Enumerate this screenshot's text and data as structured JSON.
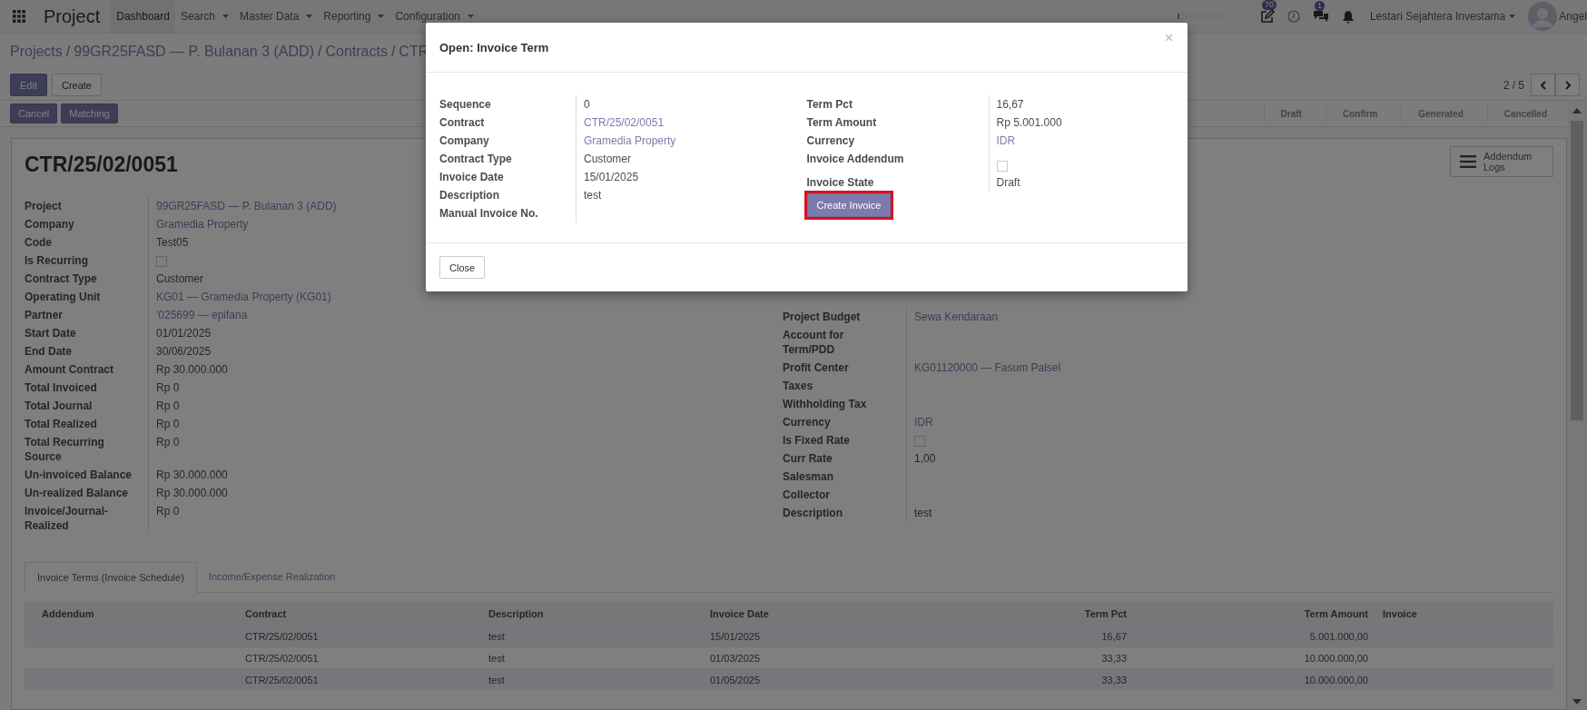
{
  "navbar": {
    "app": "Project",
    "menus": [
      {
        "label": "Dashboard",
        "selected": true,
        "dropdown": false
      },
      {
        "label": "Search",
        "selected": false,
        "dropdown": true
      },
      {
        "label": "Master Data",
        "selected": false,
        "dropdown": true
      },
      {
        "label": "Reporting",
        "selected": false,
        "dropdown": true
      },
      {
        "label": "Configuration",
        "selected": false,
        "dropdown": true
      }
    ],
    "progress": {
      "level": 0.04
    },
    "systray": [
      {
        "kind": "edit",
        "badge": "70"
      },
      {
        "kind": "clock"
      },
      {
        "kind": "chat",
        "badge": "1"
      },
      {
        "kind": "bell"
      }
    ],
    "company": "Lestari Sejahtera Investama",
    "user": "Angel"
  },
  "breadcrumb": [
    {
      "label": "Projects",
      "separator": "/"
    },
    {
      "label": "99GR25FASD — P. Bulanan 3 (ADD)",
      "separator": "/"
    },
    {
      "label": "Contracts",
      "separator": "/"
    },
    {
      "label": "CTR"
    }
  ],
  "buttons": [
    "Edit",
    "Create"
  ],
  "pager": {
    "text": "2 / 5"
  },
  "header_buttons": [
    "Cancel",
    "Matching"
  ],
  "statusbar": [
    {
      "label": "Draft",
      "selected": false
    },
    {
      "label": "Confirm",
      "selected": false
    },
    {
      "label": "Generated",
      "selected": false
    },
    {
      "label": "Cancelled",
      "selected": false
    }
  ],
  "record": {
    "title": "CTR/25/02/0051",
    "addendum_button": "Addendum Logs",
    "left_fields": [
      {
        "label": "Project",
        "kind": "link",
        "value": "99GR25FASD — P. Bulanan 3 (ADD)"
      },
      {
        "label": "Company",
        "kind": "link",
        "value": "Gramedia Property"
      },
      {
        "label": "Code",
        "kind": "text",
        "value": "Test05"
      },
      {
        "label": "Is Recurring",
        "kind": "checkbox",
        "checked": false
      },
      {
        "label": "Contract Type",
        "kind": "text",
        "value": "Customer"
      },
      {
        "label": "Operating Unit",
        "kind": "link",
        "value": "KG01 — Gramedia Property (KG01)"
      },
      {
        "label": "Partner",
        "kind": "link",
        "value": "'025699 — epifana"
      },
      {
        "label": "Start Date",
        "kind": "text",
        "value": "01/01/2025"
      },
      {
        "label": "End Date",
        "kind": "text",
        "value": "30/06/2025"
      },
      {
        "label": "Amount Contract",
        "kind": "text",
        "value": "Rp 30.000.000"
      },
      {
        "label": "Total Invoiced",
        "kind": "text",
        "value": "Rp 0"
      },
      {
        "label": "Total Journal",
        "kind": "text",
        "value": "Rp 0"
      },
      {
        "label": "Total Realized",
        "kind": "text",
        "value": "Rp 0"
      },
      {
        "label": "Total Recurring Source",
        "kind": "text",
        "value": "Rp 0"
      },
      {
        "label": "Un-invoiced Balance",
        "kind": "text",
        "value": "Rp 30.000.000"
      },
      {
        "label": "Un-realized Balance",
        "kind": "text",
        "value": "Rp 30.000.000"
      },
      {
        "label": "Invoice/Journal-Realized",
        "kind": "text",
        "value": "Rp 0"
      }
    ],
    "right_fields": [
      {
        "label": "Project Budget",
        "kind": "link",
        "value": "Sewa Kendaraan"
      },
      {
        "label": "Account for Term/PDD",
        "kind": "text"
      },
      {
        "label": "Profit Center",
        "kind": "link",
        "value": "KG01120000 — Fasum Palsel"
      },
      {
        "label": "Taxes",
        "kind": "text"
      },
      {
        "label": "Withholding Tax",
        "kind": "text"
      },
      {
        "label": "Currency",
        "kind": "link",
        "value": "IDR"
      },
      {
        "label": "Is Fixed Rate",
        "kind": "checkbox",
        "checked": false
      },
      {
        "label": "Curr Rate",
        "kind": "text",
        "value": "1,00"
      },
      {
        "label": "Salesman",
        "kind": "text"
      },
      {
        "label": "Collector",
        "kind": "text"
      },
      {
        "label": "Description",
        "kind": "text",
        "value": "test"
      }
    ]
  },
  "tabs": [
    {
      "label": "Invoice Terms (Invoice Schedule)",
      "selected": true
    },
    {
      "label": "Income/Expense Realization",
      "selected": false
    }
  ],
  "table": {
    "columns": [
      "Addendum",
      "Contract",
      "Description",
      "Invoice Date",
      "Term Pct",
      "Term Amount",
      "Invoice"
    ],
    "rows": [
      [
        "",
        "CTR/25/02/0051",
        "test",
        "15/01/2025",
        "16,67",
        "5.001.000,00",
        ""
      ],
      [
        "",
        "CTR/25/02/0051",
        "test",
        "01/03/2025",
        "33,33",
        "10.000.000,00",
        ""
      ],
      [
        "",
        "CTR/25/02/0051",
        "test",
        "01/05/2025",
        "33,33",
        "10.000.000,00",
        ""
      ]
    ]
  },
  "dialog": {
    "title": "Open: Invoice Term",
    "left_fields": [
      {
        "label": "Sequence",
        "kind": "text",
        "value": "0"
      },
      {
        "label": "Contract",
        "kind": "link",
        "value": "CTR/25/02/0051"
      },
      {
        "label": "Company",
        "kind": "link",
        "value": "Gramedia Property"
      },
      {
        "label": "Contract Type",
        "kind": "text",
        "value": "Customer"
      },
      {
        "label": "Invoice Date",
        "kind": "text",
        "value": "15/01/2025"
      },
      {
        "label": "Description",
        "kind": "text",
        "value": "test"
      },
      {
        "label": "Manual Invoice No.",
        "kind": "text"
      }
    ],
    "right_fields": [
      {
        "label": "Term Pct",
        "kind": "text",
        "value": "16,67"
      },
      {
        "label": "Term Amount",
        "kind": "text",
        "value": "Rp 5.001.000"
      },
      {
        "label": "Currency",
        "kind": "link",
        "value": "IDR"
      },
      {
        "label": "Invoice Addendum",
        "kind": "checkbox",
        "checked": false
      },
      {
        "label": "Invoice State",
        "kind": "text",
        "value": "Draft"
      }
    ],
    "action_button": {
      "label": "Create Invoice",
      "highlighted": true
    },
    "close_button": "Close"
  }
}
